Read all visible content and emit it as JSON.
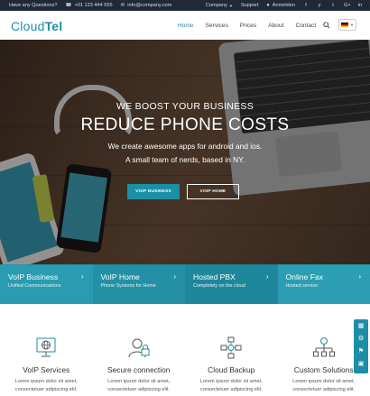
{
  "topbar": {
    "question": "Have any Questions?",
    "phone": "+01 123 444 555",
    "email": "info@company.com",
    "company": "Company",
    "support": "Support",
    "login": "Anmelden",
    "social": [
      "f",
      "y",
      "t",
      "G+",
      "in"
    ]
  },
  "header": {
    "logo_a": "Cloud",
    "logo_b": "Tel",
    "nav": [
      "Home",
      "Services",
      "Prices",
      "About",
      "Contact"
    ],
    "active_nav": "Home",
    "language": "de"
  },
  "hero": {
    "pretitle": "WE BOOST YOUR BUSINESS",
    "title": "REDUCE PHONE COSTS",
    "line1": "We create awesome apps for android and ios.",
    "line2": "A small team of nerds, based in NY.",
    "button_primary": "VOIP BUSINESS",
    "button_secondary": "VOIP HOME"
  },
  "services": [
    {
      "title": "VoIP Business",
      "desc": "Unified Communications"
    },
    {
      "title": "VoIP Home",
      "desc": "Phone Systems for Home"
    },
    {
      "title": "Hosted PBX",
      "desc": "Completely on the cloud"
    },
    {
      "title": "Online Fax",
      "desc": "Hosted service"
    }
  ],
  "features": [
    {
      "title": "VoIP Services",
      "desc1": "Lorem ipsum dolor sit amet,",
      "desc2": "consectetuer adipiscing elit."
    },
    {
      "title": "Secure connection",
      "desc1": "Lorem ipsum dolor sit amet,",
      "desc2": "consectetuer adipiscing elit."
    },
    {
      "title": "Cloud Backup",
      "desc1": "Lorem ipsum dolor sit amet,",
      "desc2": "consectetuer adipiscing elit."
    },
    {
      "title": "Custom Solutions",
      "desc1": "Lorem ipsum dolor sit amet,",
      "desc2": "consectetuer adipiscing elit."
    }
  ],
  "colors": {
    "accent": "#1b8fa6",
    "topbar": "#1f2a35"
  },
  "icons": {
    "topbar": [
      "phone-icon",
      "mail-icon",
      "user-icon"
    ],
    "features": [
      "monitor-globe-icon",
      "user-lock-icon",
      "cloud-network-icon",
      "network-tree-icon"
    ],
    "sidebar": [
      "layout-icon",
      "gear-icon",
      "tag-icon",
      "cart-icon"
    ]
  }
}
